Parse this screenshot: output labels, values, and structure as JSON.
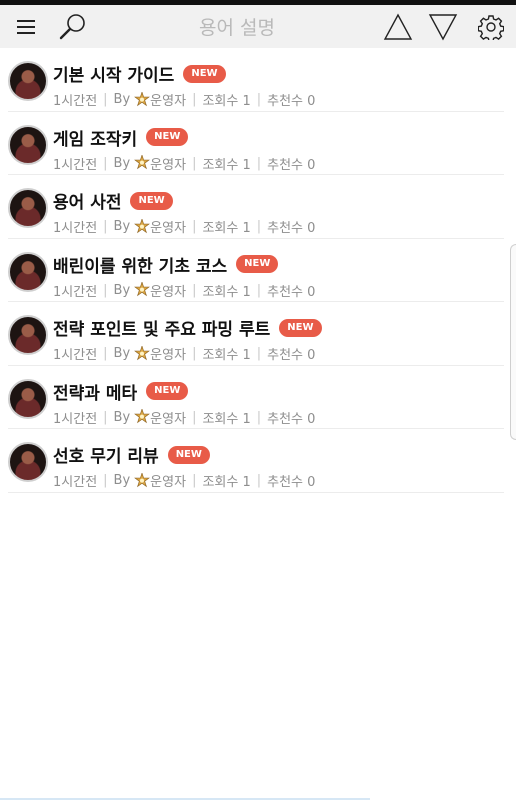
{
  "header": {
    "title": "용어 설명",
    "icons": [
      "menu-icon",
      "search-icon",
      "upvote-icon",
      "downvote-icon",
      "gear-icon"
    ]
  },
  "posts": [
    {
      "title": "기본 시작 가이드",
      "badge": "NEW",
      "time": "1시간전",
      "by": "By",
      "author": "운영자",
      "views": "조회수 1",
      "likes": "추천수 0"
    },
    {
      "title": "게임 조작키",
      "badge": "NEW",
      "time": "1시간전",
      "by": "By",
      "author": "운영자",
      "views": "조회수 1",
      "likes": "추천수 0"
    },
    {
      "title": "용어 사전",
      "badge": "NEW",
      "time": "1시간전",
      "by": "By",
      "author": "운영자",
      "views": "조회수 1",
      "likes": "추천수 0"
    },
    {
      "title": "배린이를 위한 기초 코스",
      "badge": "NEW",
      "time": "1시간전",
      "by": "By",
      "author": "운영자",
      "views": "조회수 1",
      "likes": "추천수 0"
    },
    {
      "title": "전략 포인트 및 주요 파밍 루트",
      "badge": "NEW",
      "time": "1시간전",
      "by": "By",
      "author": "운영자",
      "views": "조회수 1",
      "likes": "추천수 0"
    },
    {
      "title": "전략과 메타",
      "badge": "NEW",
      "time": "1시간전",
      "by": "By",
      "author": "운영자",
      "views": "조회수 1",
      "likes": "추천수 0"
    },
    {
      "title": "선호 무기 리뷰",
      "badge": "NEW",
      "time": "1시간전",
      "by": "By",
      "author": "운영자",
      "views": "조회수 1",
      "likes": "추천수 0"
    }
  ],
  "colors": {
    "badge": "#e85b48",
    "title": "#111111",
    "meta": "#8e8e8e",
    "header_bg": "#f1f1f1"
  }
}
